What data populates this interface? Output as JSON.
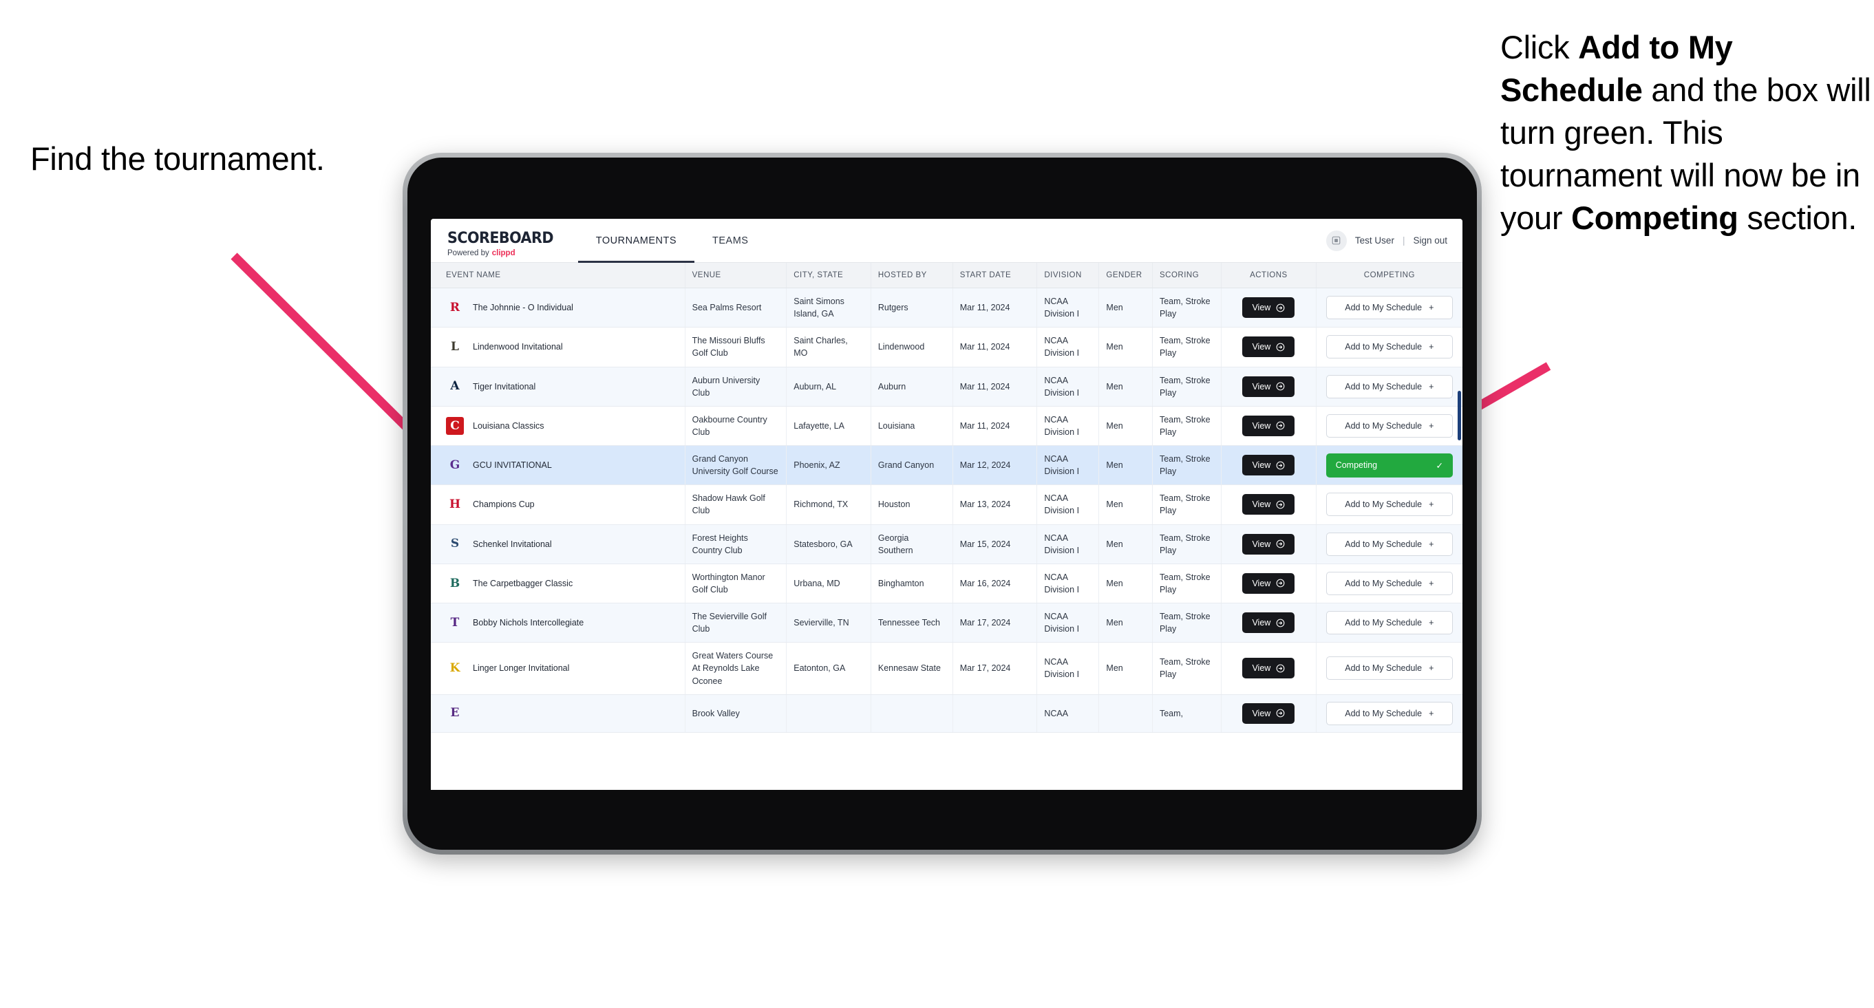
{
  "annotations": {
    "left": {
      "text": "Find the tournament."
    },
    "right": {
      "segments": [
        {
          "text": "Click ",
          "bold": false
        },
        {
          "text": "Add to My Schedule",
          "bold": true
        },
        {
          "text": " and the box will turn green. This tournament will now be in your ",
          "bold": false
        },
        {
          "text": "Competing",
          "bold": true
        },
        {
          "text": " section.",
          "bold": false
        }
      ]
    },
    "arrow_color": "#ea2f68"
  },
  "app": {
    "brand": {
      "wordmark": "SCOREBOARD",
      "tagline_prefix": "Powered by",
      "tagline_brand": "clippd"
    },
    "tabs": [
      {
        "label": "TOURNAMENTS",
        "active": true
      },
      {
        "label": "TEAMS",
        "active": false
      }
    ],
    "header_right": {
      "avatar_icon": "user-avatar-icon",
      "user_name": "Test User",
      "divider": "|",
      "sign_out": "Sign out"
    },
    "table": {
      "columns": [
        "EVENT NAME",
        "VENUE",
        "CITY, STATE",
        "HOSTED BY",
        "START DATE",
        "DIVISION",
        "GENDER",
        "SCORING",
        "ACTIONS",
        "COMPETING"
      ],
      "view_label": "View",
      "add_label": "Add to My Schedule",
      "add_plus": "+",
      "competing_label": "Competing",
      "competing_check": "✓",
      "rows": [
        {
          "logo": {
            "text": "R",
            "color": "#c8102e",
            "bg": "transparent"
          },
          "event": "The Johnnie - O Individual",
          "venue": "Sea Palms Resort",
          "city": "Saint Simons Island, GA",
          "hosted_by": "Rutgers",
          "start_date": "Mar 11, 2024",
          "division": "NCAA Division I",
          "gender": "Men",
          "scoring": "Team, Stroke Play",
          "competing": false
        },
        {
          "logo": {
            "text": "L",
            "color": "#3c3a2e",
            "bg": "transparent"
          },
          "event": "Lindenwood Invitational",
          "venue": "The Missouri Bluffs Golf Club",
          "city": "Saint Charles, MO",
          "hosted_by": "Lindenwood",
          "start_date": "Mar 11, 2024",
          "division": "NCAA Division I",
          "gender": "Men",
          "scoring": "Team, Stroke Play",
          "competing": false
        },
        {
          "logo": {
            "text": "A",
            "color": "#0c2340",
            "bg": "transparent"
          },
          "event": "Tiger Invitational",
          "venue": "Auburn University Club",
          "city": "Auburn, AL",
          "hosted_by": "Auburn",
          "start_date": "Mar 11, 2024",
          "division": "NCAA Division I",
          "gender": "Men",
          "scoring": "Team, Stroke Play",
          "competing": false
        },
        {
          "logo": {
            "text": "C",
            "color": "#ffffff",
            "bg": "#ce181e"
          },
          "event": "Louisiana Classics",
          "venue": "Oakbourne Country Club",
          "city": "Lafayette, LA",
          "hosted_by": "Louisiana",
          "start_date": "Mar 11, 2024",
          "division": "NCAA Division I",
          "gender": "Men",
          "scoring": "Team, Stroke Play",
          "competing": false
        },
        {
          "logo": {
            "text": "G",
            "color": "#5b2d8e",
            "bg": "transparent"
          },
          "event": "GCU INVITATIONAL",
          "venue": "Grand Canyon University Golf Course",
          "city": "Phoenix, AZ",
          "hosted_by": "Grand Canyon",
          "start_date": "Mar 12, 2024",
          "division": "NCAA Division I",
          "gender": "Men",
          "scoring": "Team, Stroke Play",
          "competing": true
        },
        {
          "logo": {
            "text": "H",
            "color": "#c8102e",
            "bg": "transparent"
          },
          "event": "Champions Cup",
          "venue": "Shadow Hawk Golf Club",
          "city": "Richmond, TX",
          "hosted_by": "Houston",
          "start_date": "Mar 13, 2024",
          "division": "NCAA Division I",
          "gender": "Men",
          "scoring": "Team, Stroke Play",
          "competing": false
        },
        {
          "logo": {
            "text": "S",
            "color": "#2b4a6f",
            "bg": "transparent"
          },
          "event": "Schenkel Invitational",
          "venue": "Forest Heights Country Club",
          "city": "Statesboro, GA",
          "hosted_by": "Georgia Southern",
          "start_date": "Mar 15, 2024",
          "division": "NCAA Division I",
          "gender": "Men",
          "scoring": "Team, Stroke Play",
          "competing": false
        },
        {
          "logo": {
            "text": "B",
            "color": "#1f6b5e",
            "bg": "transparent"
          },
          "event": "The Carpetbagger Classic",
          "venue": "Worthington Manor Golf Club",
          "city": "Urbana, MD",
          "hosted_by": "Binghamton",
          "start_date": "Mar 16, 2024",
          "division": "NCAA Division I",
          "gender": "Men",
          "scoring": "Team, Stroke Play",
          "competing": false
        },
        {
          "logo": {
            "text": "T",
            "color": "#552583",
            "bg": "transparent"
          },
          "event": "Bobby Nichols Intercollegiate",
          "venue": "The Sevierville Golf Club",
          "city": "Sevierville, TN",
          "hosted_by": "Tennessee Tech",
          "start_date": "Mar 17, 2024",
          "division": "NCAA Division I",
          "gender": "Men",
          "scoring": "Team, Stroke Play",
          "competing": false
        },
        {
          "logo": {
            "text": "K",
            "color": "#d9a800",
            "bg": "transparent"
          },
          "event": "Linger Longer Invitational",
          "venue": "Great Waters Course At Reynolds Lake Oconee",
          "city": "Eatonton, GA",
          "hosted_by": "Kennesaw State",
          "start_date": "Mar 17, 2024",
          "division": "NCAA Division I",
          "gender": "Men",
          "scoring": "Team, Stroke Play",
          "competing": false
        },
        {
          "logo": {
            "text": "E",
            "color": "#582c83",
            "bg": "transparent"
          },
          "event": "",
          "venue": "Brook Valley",
          "city": "",
          "hosted_by": "",
          "start_date": "",
          "division": "NCAA",
          "gender": "",
          "scoring": "Team,",
          "competing": false,
          "partial": true
        }
      ]
    }
  }
}
